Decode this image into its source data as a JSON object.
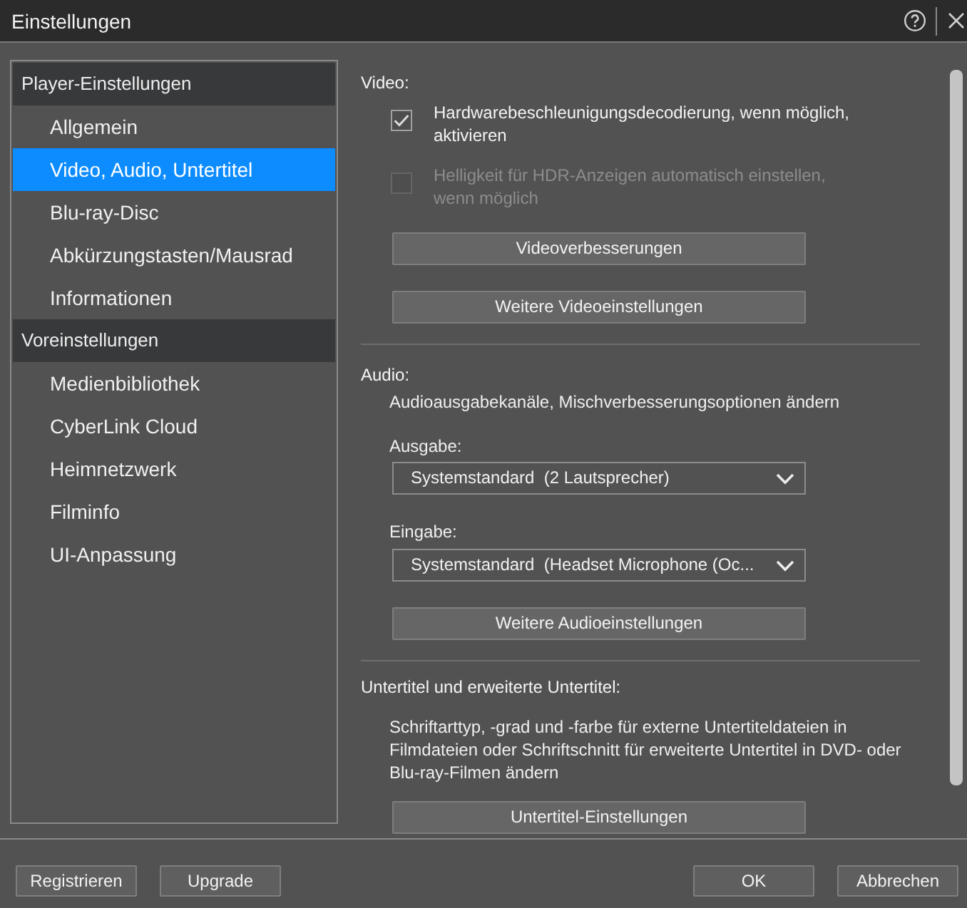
{
  "window": {
    "title": "Einstellungen"
  },
  "sidebar": {
    "groups": [
      {
        "label": "Player-Einstellungen",
        "items": [
          {
            "label": "Allgemein",
            "selected": false
          },
          {
            "label": "Video, Audio, Untertitel",
            "selected": true
          },
          {
            "label": "Blu-ray-Disc",
            "selected": false
          },
          {
            "label": "Abkürzungstasten/Mausrad",
            "selected": false
          },
          {
            "label": "Informationen",
            "selected": false
          }
        ]
      },
      {
        "label": "Voreinstellungen",
        "items": [
          {
            "label": "Medienbibliothek",
            "selected": false
          },
          {
            "label": "CyberLink Cloud",
            "selected": false
          },
          {
            "label": "Heimnetzwerk",
            "selected": false
          },
          {
            "label": "Filminfo",
            "selected": false
          },
          {
            "label": "UI-Anpassung",
            "selected": false
          }
        ]
      }
    ]
  },
  "content": {
    "sections": [
      {
        "title": "Video:",
        "controls": [
          {
            "kind": "checkbox",
            "label": "Hardwarebeschleunigungsdecodierung, wenn möglich, aktivieren",
            "checked": true,
            "disabled": false
          },
          {
            "kind": "checkbox",
            "label": "Helligkeit für HDR-Anzeigen automatisch einstellen, wenn möglich",
            "checked": false,
            "disabled": true
          },
          {
            "kind": "button",
            "label": "Videoverbesserungen"
          },
          {
            "kind": "button",
            "label": "Weitere Videoeinstellungen"
          }
        ]
      },
      {
        "title": "Audio:",
        "controls": [
          {
            "kind": "text",
            "text": "Audioausgabekanäle, Mischverbesserungsoptionen ändern"
          },
          {
            "kind": "dropdown",
            "label": "Ausgabe:",
            "value": "Systemstandard  (2 Lautsprecher)"
          },
          {
            "kind": "dropdown",
            "label": "Eingabe:",
            "value": "Systemstandard  (Headset Microphone (Oc..."
          },
          {
            "kind": "button",
            "label": "Weitere Audioeinstellungen"
          }
        ]
      },
      {
        "title": "Untertitel und erweiterte Untertitel:",
        "controls": [
          {
            "kind": "text",
            "text": "Schriftarttyp, -grad und -farbe für externe Untertiteldateien in Filmdateien oder Schriftschnitt für erweiterte Untertitel in DVD- oder Blu-ray-Filmen ändern"
          },
          {
            "kind": "button",
            "label": "Untertitel-Einstellungen"
          }
        ]
      }
    ]
  },
  "footer": {
    "left_buttons": [
      "Registrieren",
      "Upgrade"
    ],
    "right_buttons": [
      "OK",
      "Abbrechen"
    ]
  }
}
